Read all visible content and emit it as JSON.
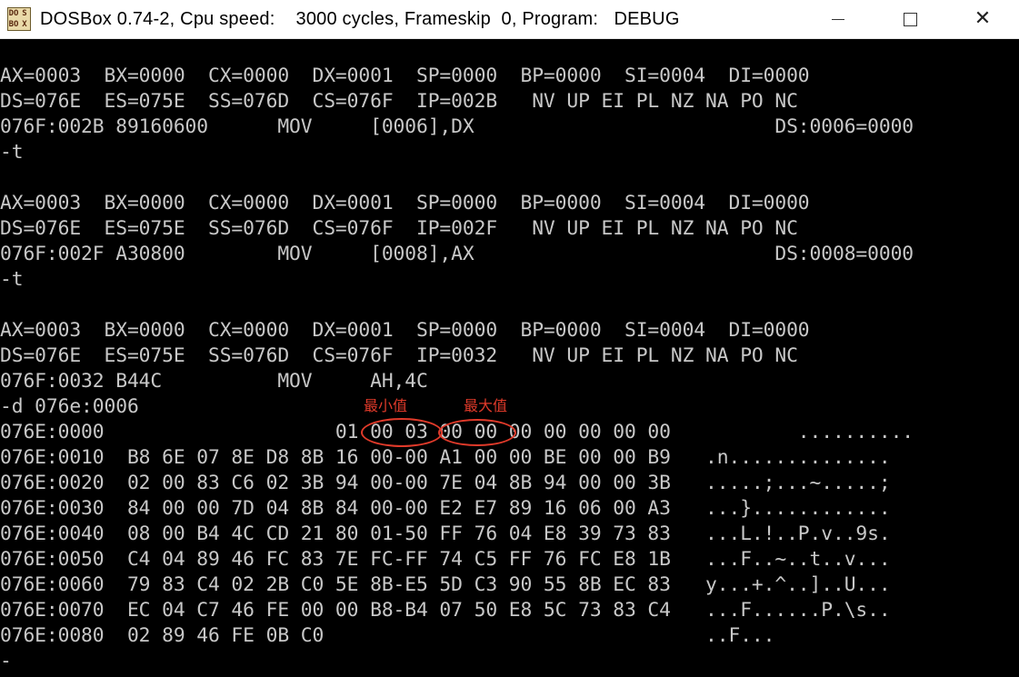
{
  "window": {
    "icon_letters": [
      "DO",
      "S",
      "BO",
      "X"
    ],
    "title": "DOSBox 0.74-2, Cpu speed:    3000 cycles, Frameskip  0, Program:   DEBUG",
    "controls": {
      "minimize": "minimize",
      "maximize": "maximize",
      "close": "✕"
    }
  },
  "console": {
    "lines": [
      "AX=0003  BX=0000  CX=0000  DX=0001  SP=0000  BP=0000  SI=0004  DI=0000",
      "DS=076E  ES=075E  SS=076D  CS=076F  IP=002B   NV UP EI PL NZ NA PO NC",
      "076F:002B 89160600      MOV     [0006],DX                          DS:0006=0000",
      "-t",
      "",
      "AX=0003  BX=0000  CX=0000  DX=0001  SP=0000  BP=0000  SI=0004  DI=0000",
      "DS=076E  ES=075E  SS=076D  CS=076F  IP=002F   NV UP EI PL NZ NA PO NC",
      "076F:002F A30800        MOV     [0008],AX                          DS:0008=0000",
      "-t",
      "",
      "AX=0003  BX=0000  CX=0000  DX=0001  SP=0000  BP=0000  SI=0004  DI=0000",
      "DS=076E  ES=075E  SS=076D  CS=076F  IP=0032   NV UP EI PL NZ NA PO NC",
      "076F:0032 B44C          MOV     AH,4C",
      "-d 076e:0006",
      "076E:0000                    01 00 03 00 00 00 00 00 00 00           ..........",
      "076E:0010  B8 6E 07 8E D8 8B 16 00-00 A1 00 00 BE 00 00 B9   .n..............",
      "076E:0020  02 00 83 C6 02 3B 94 00-00 7E 04 8B 94 00 00 3B   .....;...~.....;",
      "076E:0030  84 00 00 7D 04 8B 84 00-00 E2 E7 89 16 06 00 A3   ...}............",
      "076E:0040  08 00 B4 4C CD 21 80 01-50 FF 76 04 E8 39 73 83   ...L.!..P.v..9s.",
      "076E:0050  C4 04 89 46 FC 83 7E FC-FF 74 C5 FF 76 FC E8 1B   ...F..~..t..v...",
      "076E:0060  79 83 C4 02 2B C0 5E 8B-E5 5D C3 90 55 8B EC 83   y...+.^..]..U...",
      "076E:0070  EC 04 C7 46 FE 00 00 B8-B4 07 50 E8 5C 73 83 C4   ...F......P.\\s..",
      "076E:0080  02 89 46 FE 0B C0                                 ..F...",
      "-"
    ]
  },
  "annotations": {
    "min_label": "最小值",
    "max_label": "最大值",
    "color": "#e03a2a"
  }
}
